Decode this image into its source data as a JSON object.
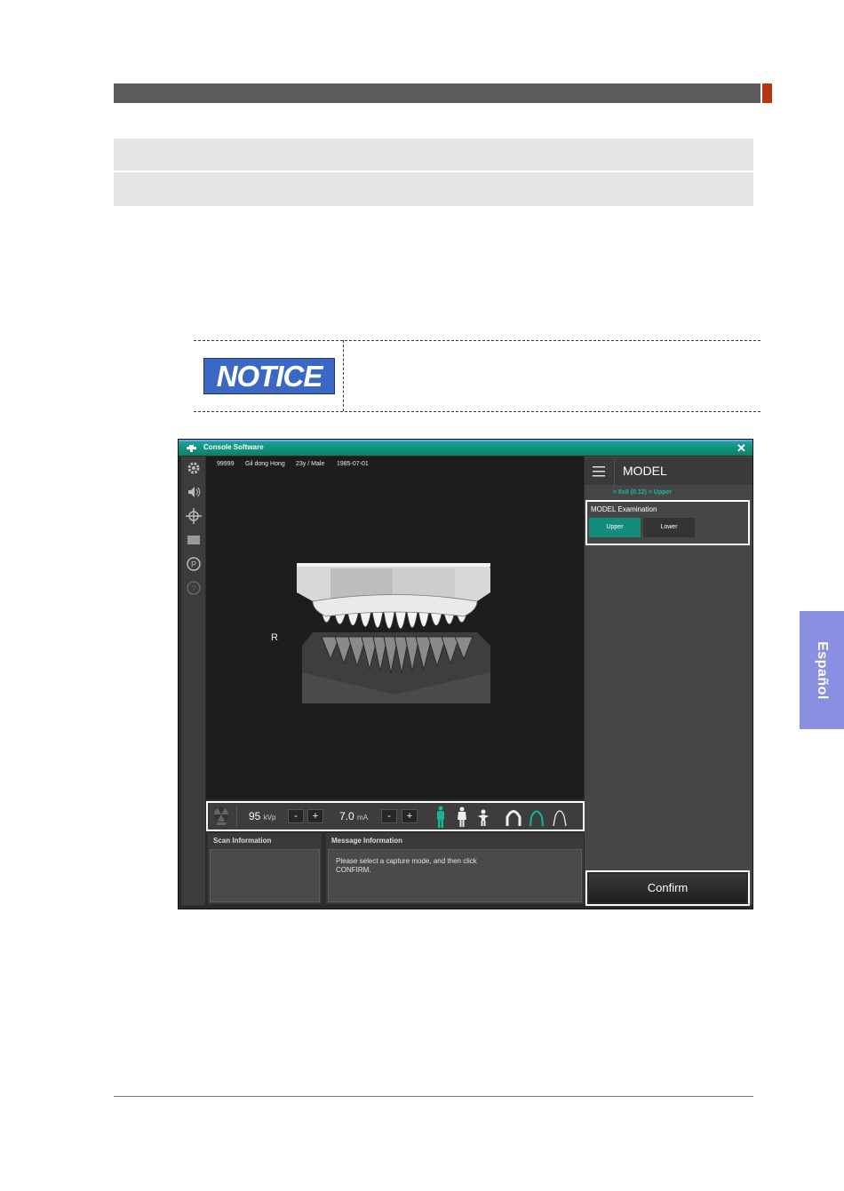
{
  "notice": {
    "badge": "NOTICE"
  },
  "side_tab": {
    "label": "Español"
  },
  "app": {
    "title": "Console Software",
    "close_glyph": "✕",
    "patient": {
      "id": "99999",
      "name": "Gil dong Hong",
      "age_sex": "23y / Male",
      "dob": "1985-07-01"
    },
    "orientation_label": "R",
    "exposure": {
      "kvp_value": "95",
      "kvp_unit": "kVp",
      "ma_value": "7.0",
      "ma_unit": "mA",
      "minus": "-",
      "plus": "+"
    },
    "scan_info": {
      "title": "Scan Information"
    },
    "message_info": {
      "title": "Message Information",
      "text_line1": "Please select a capture mode, and then click",
      "text_line2": "CONFIRM."
    },
    "right_panel": {
      "title": "MODEL",
      "breadcrumb": "> 8x8 (0.12) > Upper",
      "exam_label": "MODEL Examination",
      "upper_label": "Upper",
      "lower_label": "Lower",
      "confirm_label": "Confirm"
    },
    "colors": {
      "accent": "#138c7b",
      "notice": "#3a68c4",
      "side_tab": "#8a8fe2"
    },
    "icons": [
      "settings-icon",
      "speaker-icon",
      "laser-align-icon",
      "monitor-icon",
      "p-icon",
      "query-icon",
      "radiation-icon",
      "adult-icon",
      "child-icon",
      "small-child-icon",
      "arch-wide-icon",
      "arch-normal-icon",
      "arch-narrow-icon",
      "menu-icon",
      "close-icon"
    ]
  }
}
